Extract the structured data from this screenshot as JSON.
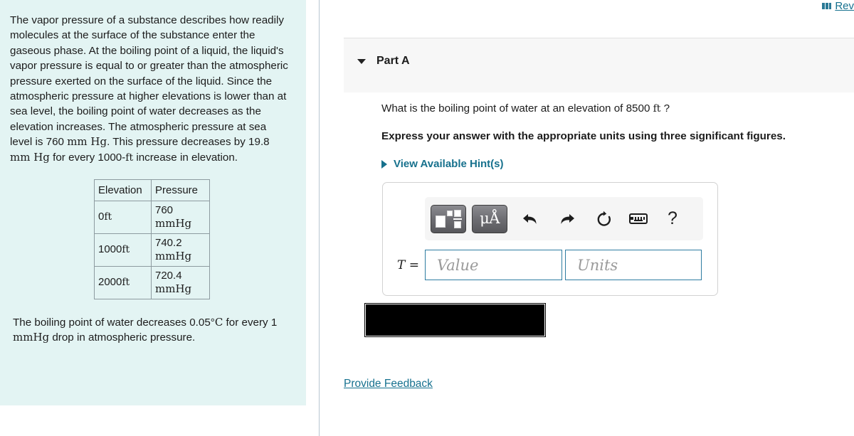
{
  "intro": {
    "paragraph": "The vapor pressure of a substance describes how readily molecules at the surface of the substance enter the gaseous phase. At the boiling point of a liquid, the liquid's vapor pressure is equal to or greater than the atmospheric pressure exerted on the surface of the liquid. Since the atmospheric pressure at higher elevations is lower than at sea level, the boiling point of water decreases as the elevation increases. The atmospheric pressure at sea level is 760 mm Hg. This pressure decreases by 19.8 mm Hg for every 1000-ft increase in elevation.",
    "paragraph_parts": {
      "seg1": "The vapor pressure of a substance describes how readily molecules at the surface of the substance enter the gaseous phase. At the boiling point of a liquid, the liquid's vapor pressure is equal to or greater than the atmospheric pressure exerted on the surface of the liquid. Since the atmospheric pressure at higher elevations is lower than at sea level, the boiling point of water decreases as the elevation increases. The atmospheric pressure at sea level is 760 ",
      "unit1": "mm Hg",
      "seg2": ". This pressure decreases by 19.8 ",
      "unit2": "mm Hg",
      "seg3": " for every 1000-",
      "unit3": "ft",
      "seg4": " increase in elevation."
    },
    "footnote_parts": {
      "seg1": "The boiling point of water decreases 0.05",
      "deg": "°",
      "unit1": "C",
      "seg2": " for every 1 ",
      "unit2": "mmHg",
      "seg3": " drop in atmospheric pressure."
    },
    "footnote": "The boiling point of water decreases 0.05°C for every 1 mmHg drop in atmospheric pressure."
  },
  "elevation_table": {
    "headers": [
      "Elevation",
      "Pressure"
    ],
    "rows": [
      {
        "elevation_value": "0",
        "elevation_unit": "ft",
        "pressure_value": "760",
        "pressure_unit": "mmHg"
      },
      {
        "elevation_value": "1000",
        "elevation_unit": "ft",
        "pressure_value": "740.2",
        "pressure_unit": "mmHg"
      },
      {
        "elevation_value": "2000",
        "elevation_unit": "ft",
        "pressure_value": "720.4",
        "pressure_unit": "mmHg"
      }
    ]
  },
  "review": {
    "label": "Rev",
    "icon": "review-chart-icon"
  },
  "part": {
    "title": "Part A",
    "caret_icon": "caret-down-icon"
  },
  "question": {
    "text_parts": {
      "seg1": "What is the boiling point of water at an elevation of 8500 ",
      "unit": "ft",
      "seg2": " ?"
    },
    "text": "What is the boiling point of water at an elevation of 8500 ft ?",
    "instruction": "Express your answer with the appropriate units using three significant figures.",
    "hints_label": "View Available Hint(s)",
    "hints_caret_icon": "caret-right-icon"
  },
  "answer": {
    "variable_label": "T",
    "equals": "=",
    "value_placeholder": "Value",
    "units_placeholder": "Units",
    "toolbar": {
      "template_button": "template-icon",
      "units_button": "μÅ",
      "undo_button": "undo-icon",
      "redo_button": "redo-icon",
      "reset_button": "reset-icon",
      "keyboard_button": "keyboard-icon",
      "help_button": "?"
    }
  },
  "footer": {
    "provide_feedback": "Provide Feedback"
  },
  "colors": {
    "intro_panel_bg": "#e3f4f3",
    "link_teal": "#16718f",
    "hint_teal": "#17718d",
    "part_band_bg": "#f7f7f7",
    "field_border": "#2e7ca1",
    "redacted": "#000000"
  }
}
